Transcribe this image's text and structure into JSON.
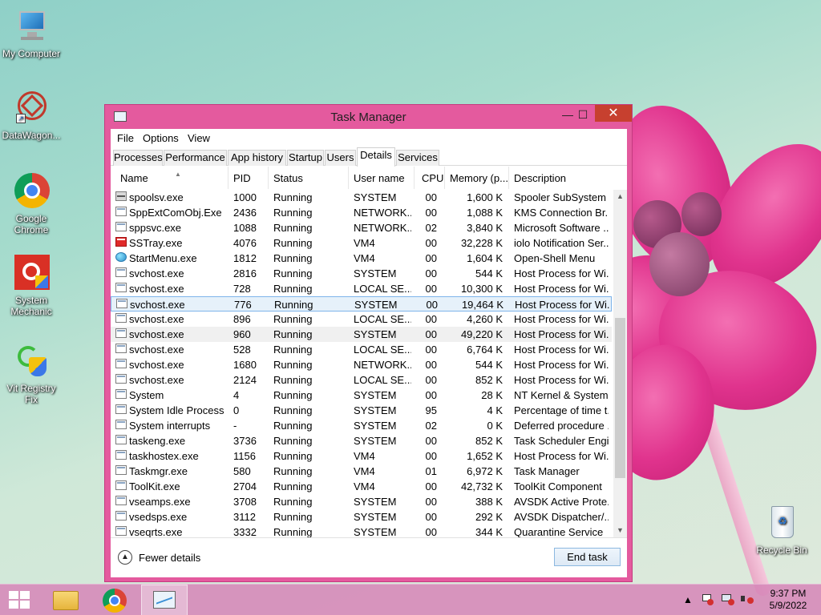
{
  "desktop": {
    "icons": [
      {
        "label": "My Computer"
      },
      {
        "label": "DataWagon..."
      },
      {
        "label": "Google Chrome"
      },
      {
        "label": "System Mechanic"
      },
      {
        "label": "Vit Registry Fix"
      },
      {
        "label": "Recycle Bin"
      }
    ]
  },
  "window": {
    "title": "Task Manager",
    "minimize_glyph": "—",
    "maximize_glyph": "☐",
    "close_glyph": "✕"
  },
  "menu": [
    "File",
    "Options",
    "View"
  ],
  "tabs": [
    {
      "label": "Processes"
    },
    {
      "label": "Performance"
    },
    {
      "label": "App history"
    },
    {
      "label": "Startup"
    },
    {
      "label": "Users"
    },
    {
      "label": "Details",
      "active": true
    },
    {
      "label": "Services"
    }
  ],
  "columns": [
    "Name",
    "PID",
    "Status",
    "User name",
    "CPU",
    "Memory (p...",
    "Description"
  ],
  "rows": [
    {
      "icon": "printer-icon",
      "name": "spoolsv.exe",
      "pid": "1000",
      "status": "Running",
      "user": "SYSTEM",
      "cpu": "00",
      "mem": "1,600 K",
      "desc": "Spooler SubSystem ..."
    },
    {
      "icon": "app-icon",
      "name": "SppExtComObj.Exe",
      "pid": "2436",
      "status": "Running",
      "user": "NETWORK...",
      "cpu": "00",
      "mem": "1,088 K",
      "desc": "KMS Connection Br..."
    },
    {
      "icon": "app-icon",
      "name": "sppsvc.exe",
      "pid": "1088",
      "status": "Running",
      "user": "NETWORK...",
      "cpu": "02",
      "mem": "3,840 K",
      "desc": "Microsoft Software ..."
    },
    {
      "icon": "sstray-icon",
      "name": "SSTray.exe",
      "pid": "4076",
      "status": "Running",
      "user": "VM4",
      "cpu": "00",
      "mem": "32,228 K",
      "desc": "iolo Notification Ser..."
    },
    {
      "icon": "globe-icon",
      "name": "StartMenu.exe",
      "pid": "1812",
      "status": "Running",
      "user": "VM4",
      "cpu": "00",
      "mem": "1,604 K",
      "desc": "Open-Shell Menu"
    },
    {
      "icon": "app-icon",
      "name": "svchost.exe",
      "pid": "2816",
      "status": "Running",
      "user": "SYSTEM",
      "cpu": "00",
      "mem": "544 K",
      "desc": "Host Process for Wi..."
    },
    {
      "icon": "app-icon",
      "name": "svchost.exe",
      "pid": "728",
      "status": "Running",
      "user": "LOCAL SE...",
      "cpu": "00",
      "mem": "10,300 K",
      "desc": "Host Process for Wi..."
    },
    {
      "icon": "app-icon",
      "name": "svchost.exe",
      "pid": "776",
      "status": "Running",
      "user": "SYSTEM",
      "cpu": "00",
      "mem": "19,464 K",
      "desc": "Host Process for Wi...",
      "state": "selected"
    },
    {
      "icon": "app-icon",
      "name": "svchost.exe",
      "pid": "896",
      "status": "Running",
      "user": "LOCAL SE...",
      "cpu": "00",
      "mem": "4,260 K",
      "desc": "Host Process for Wi..."
    },
    {
      "icon": "app-icon",
      "name": "svchost.exe",
      "pid": "960",
      "status": "Running",
      "user": "SYSTEM",
      "cpu": "00",
      "mem": "49,220 K",
      "desc": "Host Process for Wi...",
      "state": "hover"
    },
    {
      "icon": "app-icon",
      "name": "svchost.exe",
      "pid": "528",
      "status": "Running",
      "user": "LOCAL SE...",
      "cpu": "00",
      "mem": "6,764 K",
      "desc": "Host Process for Wi..."
    },
    {
      "icon": "app-icon",
      "name": "svchost.exe",
      "pid": "1680",
      "status": "Running",
      "user": "NETWORK...",
      "cpu": "00",
      "mem": "544 K",
      "desc": "Host Process for Wi..."
    },
    {
      "icon": "app-icon",
      "name": "svchost.exe",
      "pid": "2124",
      "status": "Running",
      "user": "LOCAL SE...",
      "cpu": "00",
      "mem": "852 K",
      "desc": "Host Process for Wi..."
    },
    {
      "icon": "app-icon",
      "name": "System",
      "pid": "4",
      "status": "Running",
      "user": "SYSTEM",
      "cpu": "00",
      "mem": "28 K",
      "desc": "NT Kernel & System"
    },
    {
      "icon": "app-icon",
      "name": "System Idle Process",
      "pid": "0",
      "status": "Running",
      "user": "SYSTEM",
      "cpu": "95",
      "mem": "4 K",
      "desc": "Percentage of time t..."
    },
    {
      "icon": "app-icon",
      "name": "System interrupts",
      "pid": "-",
      "status": "Running",
      "user": "SYSTEM",
      "cpu": "02",
      "mem": "0 K",
      "desc": "Deferred procedure ..."
    },
    {
      "icon": "app-icon",
      "name": "taskeng.exe",
      "pid": "3736",
      "status": "Running",
      "user": "SYSTEM",
      "cpu": "00",
      "mem": "852 K",
      "desc": "Task Scheduler Engi..."
    },
    {
      "icon": "app-icon",
      "name": "taskhostex.exe",
      "pid": "1156",
      "status": "Running",
      "user": "VM4",
      "cpu": "00",
      "mem": "1,652 K",
      "desc": "Host Process for Wi..."
    },
    {
      "icon": "taskmgr-icon",
      "name": "Taskmgr.exe",
      "pid": "580",
      "status": "Running",
      "user": "VM4",
      "cpu": "01",
      "mem": "6,972 K",
      "desc": "Task Manager"
    },
    {
      "icon": "app-icon",
      "name": "ToolKit.exe",
      "pid": "2704",
      "status": "Running",
      "user": "VM4",
      "cpu": "00",
      "mem": "42,732 K",
      "desc": "ToolKit Component"
    },
    {
      "icon": "app-icon",
      "name": "vseamps.exe",
      "pid": "3708",
      "status": "Running",
      "user": "SYSTEM",
      "cpu": "00",
      "mem": "388 K",
      "desc": "AVSDK Active Prote..."
    },
    {
      "icon": "app-icon",
      "name": "vsedsps.exe",
      "pid": "3112",
      "status": "Running",
      "user": "SYSTEM",
      "cpu": "00",
      "mem": "292 K",
      "desc": "AVSDK Dispatcher/..."
    },
    {
      "icon": "app-icon",
      "name": "vseqrts.exe",
      "pid": "3332",
      "status": "Running",
      "user": "SYSTEM",
      "cpu": "00",
      "mem": "344 K",
      "desc": "Quarantine Service"
    }
  ],
  "footer": {
    "fewer_details": "Fewer details",
    "end_task": "End task"
  },
  "taskbar": {
    "time": "9:37 PM",
    "date": "5/9/2022"
  },
  "colors": {
    "window_frame": "#e45a9e",
    "close_button": "#c7402f",
    "selection": "#e6f1fa",
    "taskbar": "#d688b8"
  }
}
